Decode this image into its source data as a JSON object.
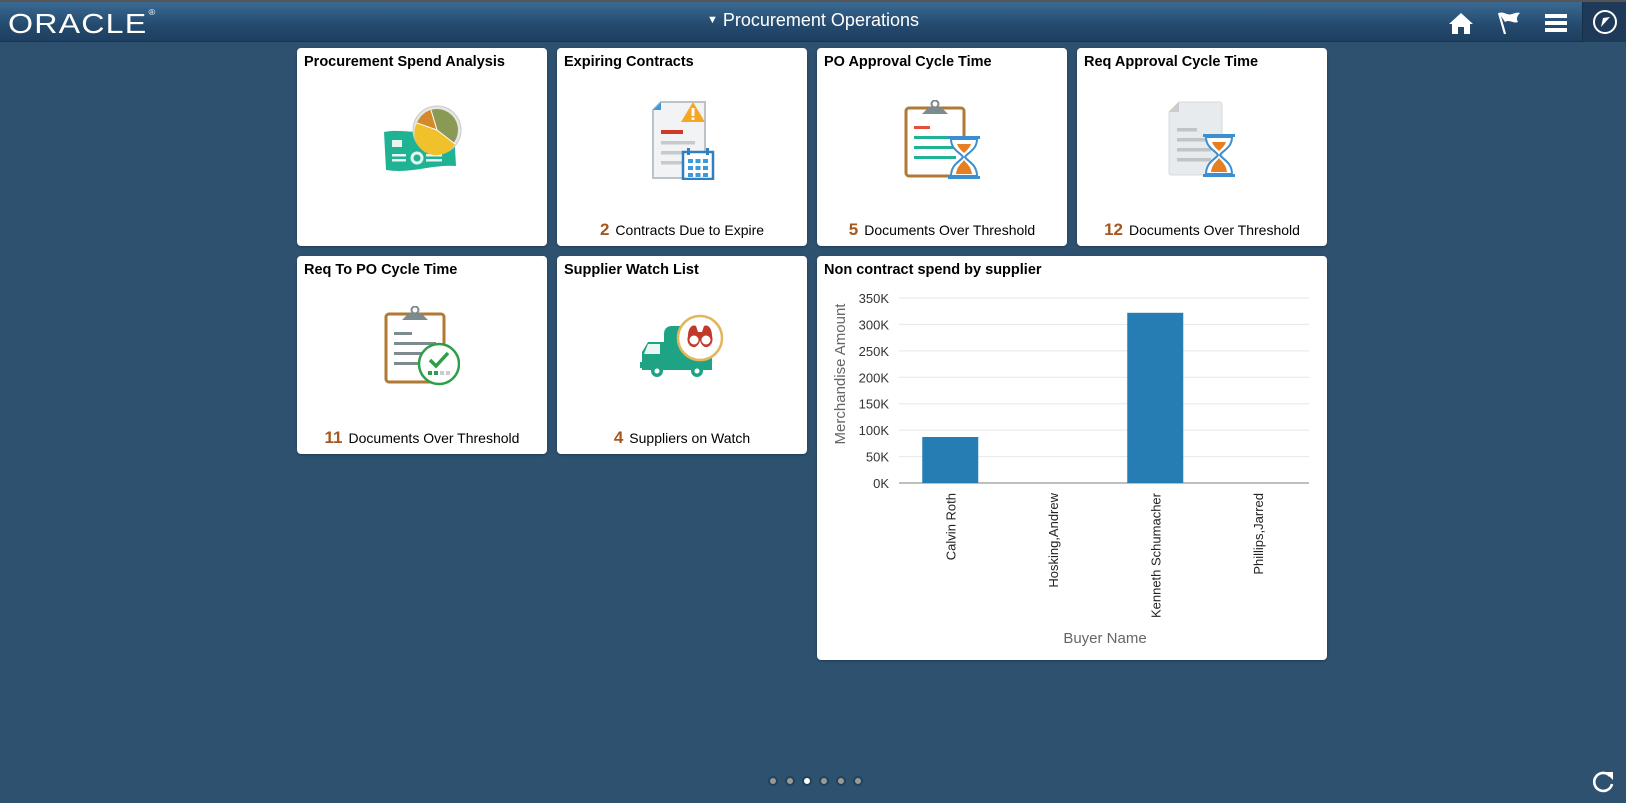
{
  "header": {
    "logo_text": "ORACLE",
    "logo_mark": "®",
    "title": "Procurement Operations",
    "title_caret": "▼",
    "actions": [
      {
        "name": "home",
        "icon": "home-icon"
      },
      {
        "name": "notifications",
        "icon": "flag-icon"
      },
      {
        "name": "actions-list",
        "icon": "hamburger-menu-icon"
      },
      {
        "name": "navbar",
        "icon": "compass-icon"
      }
    ]
  },
  "tiles": [
    {
      "title": "Procurement Spend Analysis",
      "icon": "spend-analysis-icon",
      "count": "",
      "count_label": ""
    },
    {
      "title": "Expiring Contracts",
      "icon": "expiring-contracts-icon",
      "count": "2",
      "count_label": "Contracts Due to Expire"
    },
    {
      "title": "PO Approval Cycle Time",
      "icon": "po-approval-icon",
      "count": "5",
      "count_label": "Documents Over Threshold"
    },
    {
      "title": "Req Approval Cycle Time",
      "icon": "req-approval-icon",
      "count": "12",
      "count_label": "Documents Over Threshold"
    },
    {
      "title": "Req To PO Cycle Time",
      "icon": "req-to-po-icon",
      "count": "11",
      "count_label": "Documents Over Threshold"
    },
    {
      "title": "Supplier Watch List",
      "icon": "supplier-watch-icon",
      "count": "4",
      "count_label": "Suppliers on Watch"
    }
  ],
  "chart_tile": {
    "title": "Non contract spend by supplier"
  },
  "chart_data": {
    "type": "bar",
    "title": "Non contract spend by supplier",
    "xlabel": "Buyer Name",
    "ylabel": "Merchandise Amount",
    "categories": [
      "Calvin Roth",
      "Hosking,Andrew",
      "Kenneth Schumacher",
      "Phillips,Jarred"
    ],
    "values": [
      87000,
      0,
      322000,
      0
    ],
    "ylim": [
      0,
      350000
    ],
    "yticks": [
      0,
      50000,
      100000,
      150000,
      200000,
      250000,
      300000,
      350000
    ],
    "ytick_labels": [
      "0K",
      "50K",
      "100K",
      "150K",
      "200K",
      "250K",
      "300K",
      "350K"
    ],
    "grid": true,
    "bar_color": "#267db3",
    "legend": "none"
  },
  "pagination": {
    "pages": 6,
    "active_index": 2
  },
  "footer": {
    "refresh_icon": "refresh-icon"
  },
  "colors": {
    "background": "#2e5170",
    "count_accent": "#a5571c"
  }
}
